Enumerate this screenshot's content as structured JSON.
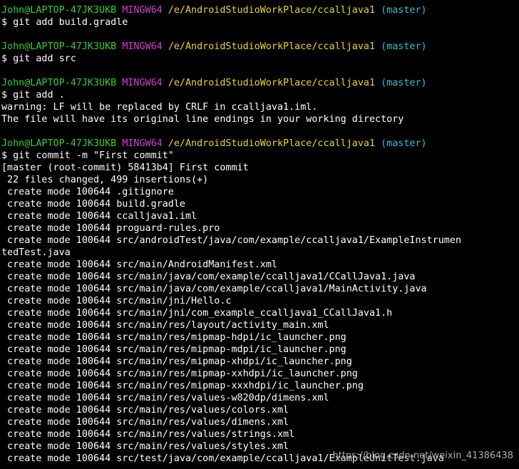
{
  "prompt": {
    "user_host": "John@LAPTOP-47JK3UKB",
    "env": "MINGW64",
    "path": "/e/AndroidStudioWorkPlace/ccalljava1",
    "branch": "(master)"
  },
  "blocks": [
    {
      "command": "$ git add build.gradle",
      "output": []
    },
    {
      "command": "$ git add src",
      "output": []
    },
    {
      "command": "$ git add .",
      "output": [
        "warning: LF will be replaced by CRLF in ccalljava1.iml.",
        "The file will have its original line endings in your working directory"
      ]
    },
    {
      "command": "$ git commit -m \"First commit\"",
      "output": [
        "[master (root-commit) 58413b4] First commit",
        " 22 files changed, 499 insertions(+)",
        " create mode 100644 .gitignore",
        " create mode 100644 build.gradle",
        " create mode 100644 ccalljava1.iml",
        " create mode 100644 proguard-rules.pro",
        " create mode 100644 src/androidTest/java/com/example/ccalljava1/ExampleInstrumen",
        "tedTest.java",
        " create mode 100644 src/main/AndroidManifest.xml",
        " create mode 100644 src/main/java/com/example/ccalljava1/CCallJava1.java",
        " create mode 100644 src/main/java/com/example/ccalljava1/MainActivity.java",
        " create mode 100644 src/main/jni/Hello.c",
        " create mode 100644 src/main/jni/com_example_ccalljava1_CCallJava1.h",
        " create mode 100644 src/main/res/layout/activity_main.xml",
        " create mode 100644 src/main/res/mipmap-hdpi/ic_launcher.png",
        " create mode 100644 src/main/res/mipmap-mdpi/ic_launcher.png",
        " create mode 100644 src/main/res/mipmap-xhdpi/ic_launcher.png",
        " create mode 100644 src/main/res/mipmap-xxhdpi/ic_launcher.png",
        " create mode 100644 src/main/res/mipmap-xxxhdpi/ic_launcher.png",
        " create mode 100644 src/main/res/values-w820dp/dimens.xml",
        " create mode 100644 src/main/res/values/colors.xml",
        " create mode 100644 src/main/res/values/dimens.xml",
        " create mode 100644 src/main/res/values/strings.xml",
        " create mode 100644 src/main/res/values/styles.xml",
        " create mode 100644 src/test/java/com/example/ccalljava1/ExampleUnitTest.java"
      ]
    }
  ],
  "watermark": "https://blog.csdn.net/weixin_41386438",
  "colors": {
    "background": "#000000",
    "text": "#ffffff",
    "user_host": "#36cc36",
    "env": "#cf42cf",
    "path": "#e8d62c",
    "branch": "#2fc3d6"
  }
}
